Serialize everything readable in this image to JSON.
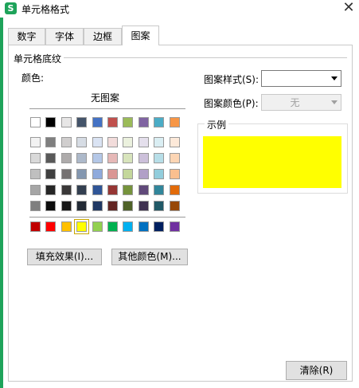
{
  "window": {
    "title": "单元格格式",
    "app_icon_letter": "S"
  },
  "tabs": [
    {
      "label": "数字"
    },
    {
      "label": "字体"
    },
    {
      "label": "边框"
    },
    {
      "label": "图案"
    }
  ],
  "section": {
    "label": "单元格底纹"
  },
  "color_label": "颜色:",
  "no_pattern_label": "无图案",
  "swatches": {
    "first_row": [
      "#ffffff",
      "#000000",
      "#e7e6e6",
      "#44546a",
      "#4472c4",
      "#c0504d",
      "#9bbb59",
      "#8064a2",
      "#4bacc6",
      "#f79646"
    ],
    "shade_rows": [
      [
        "#f2f2f2",
        "#7f7f7f",
        "#d0cece",
        "#d6dce4",
        "#dae3f3",
        "#f2dcdb",
        "#ebf1de",
        "#e4dfec",
        "#daeef3",
        "#fde9d9"
      ],
      [
        "#d9d9d9",
        "#595959",
        "#aeabab",
        "#adb9ca",
        "#b4c7e7",
        "#e6b8b7",
        "#d8e4bc",
        "#ccc0da",
        "#b7dee8",
        "#fcd5b4"
      ],
      [
        "#bfbfbf",
        "#3f3f3f",
        "#757171",
        "#8497b0",
        "#8faadc",
        "#da9694",
        "#c4d79b",
        "#b1a0c7",
        "#92cddc",
        "#fabf8f"
      ],
      [
        "#a6a6a6",
        "#262626",
        "#3a3838",
        "#333f50",
        "#2f5597",
        "#963634",
        "#76933c",
        "#60497a",
        "#31869b",
        "#e26b0a"
      ],
      [
        "#7f7f7f",
        "#0d0d0d",
        "#171616",
        "#222a35",
        "#1f3864",
        "#632523",
        "#4f6228",
        "#3f3151",
        "#215967",
        "#974706"
      ]
    ],
    "standard_row": [
      "#c00000",
      "#ff0000",
      "#ffc000",
      "#ffff00",
      "#92d050",
      "#00b050",
      "#00b0f0",
      "#0070c0",
      "#002060",
      "#7030a0"
    ],
    "selected_color": "#ffff00"
  },
  "buttons": {
    "fill_effects": "填充效果(I)...",
    "more_colors": "其他颜色(M)...",
    "clear": "清除(R)"
  },
  "pattern_style": {
    "label": "图案样式(S):",
    "value": ""
  },
  "pattern_color": {
    "label": "图案颜色(P):",
    "value": "无"
  },
  "sample": {
    "label": "示例",
    "preview_color": "#ffff00"
  }
}
